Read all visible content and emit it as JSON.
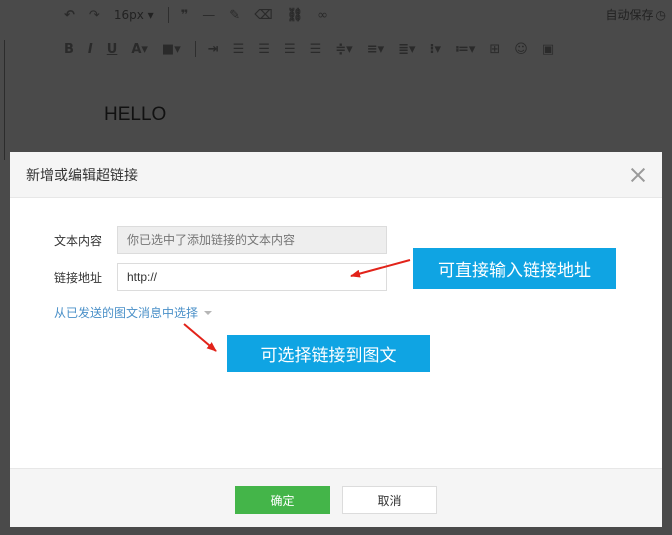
{
  "editor": {
    "font_size": "16px",
    "autosave_label": "自动保存",
    "content_text": "HELLO",
    "icons_row1": [
      "undo-icon",
      "redo-icon",
      "quote-icon",
      "horizontal-rule-icon",
      "format-brush-icon",
      "clear-format-icon",
      "link-icon",
      "unlink-icon"
    ],
    "icons_row2": [
      "bold-icon",
      "italic-icon",
      "underline-icon",
      "font-color-icon",
      "bg-color-icon",
      "indent-icon",
      "align-left-icon",
      "align-center-icon",
      "align-right-icon",
      "align-justify-icon",
      "line-height-icon",
      "paragraph-spacing-icon",
      "letter-spacing-icon",
      "list-icon",
      "ordered-list-icon",
      "table-icon",
      "emoji-icon",
      "image-icon"
    ]
  },
  "dialog": {
    "title": "新增或编辑超链接",
    "text_label": "文本内容",
    "text_placeholder": "你已选中了添加链接的文本内容",
    "link_label": "链接地址",
    "link_value": "http://",
    "pick_from_sent": "从已发送的图文消息中选择",
    "ok_label": "确定",
    "cancel_label": "取消"
  },
  "annotations": {
    "callout_direct": "可直接输入链接地址",
    "callout_select": "可选择链接到图文",
    "arrow_color": "#e2231a",
    "callout_color": "#0fa4e3"
  },
  "colors": {
    "ok_button": "#44b549",
    "link_text": "#4a90c8",
    "overlay": "#4a4a4a"
  }
}
